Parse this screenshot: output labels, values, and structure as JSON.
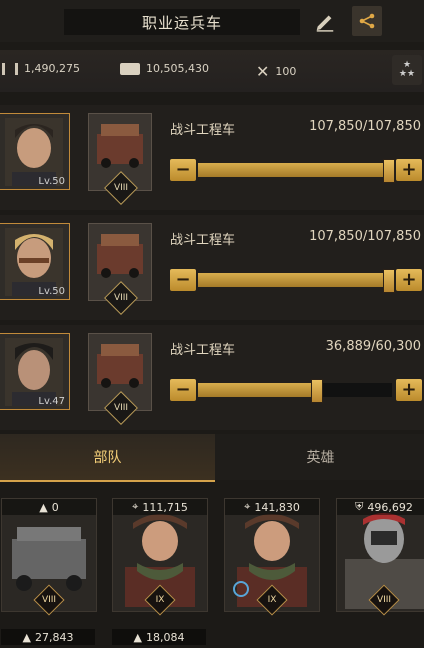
{
  "header": {
    "title": "职业运兵车"
  },
  "stats": {
    "ammo": "1,490,275",
    "truck_capacity": "10,505,430",
    "repair": "100"
  },
  "slots": [
    {
      "hero_level": "Lv.50",
      "unit_name": "战斗工程车",
      "count": "107,850/107,850",
      "rank": "VIII",
      "fill_pct": 100
    },
    {
      "hero_level": "Lv.50",
      "unit_name": "战斗工程车",
      "count": "107,850/107,850",
      "rank": "VIII",
      "fill_pct": 100
    },
    {
      "hero_level": "Lv.47",
      "unit_name": "战斗工程车",
      "count": "36,889/60,300",
      "rank": "VIII",
      "fill_pct": 61
    }
  ],
  "tabs": {
    "troops": "部队",
    "heroes": "英雄"
  },
  "units": [
    {
      "count": "0",
      "rank": "VIII"
    },
    {
      "count": "111,715",
      "rank": "IX"
    },
    {
      "count": "141,830",
      "rank": "IX"
    },
    {
      "count": "496,692",
      "rank": "VIII"
    }
  ],
  "bottom_counts": [
    "27,843",
    "18,084"
  ],
  "colors": {
    "accent": "#d6a547",
    "bg": "#1c1a17"
  }
}
